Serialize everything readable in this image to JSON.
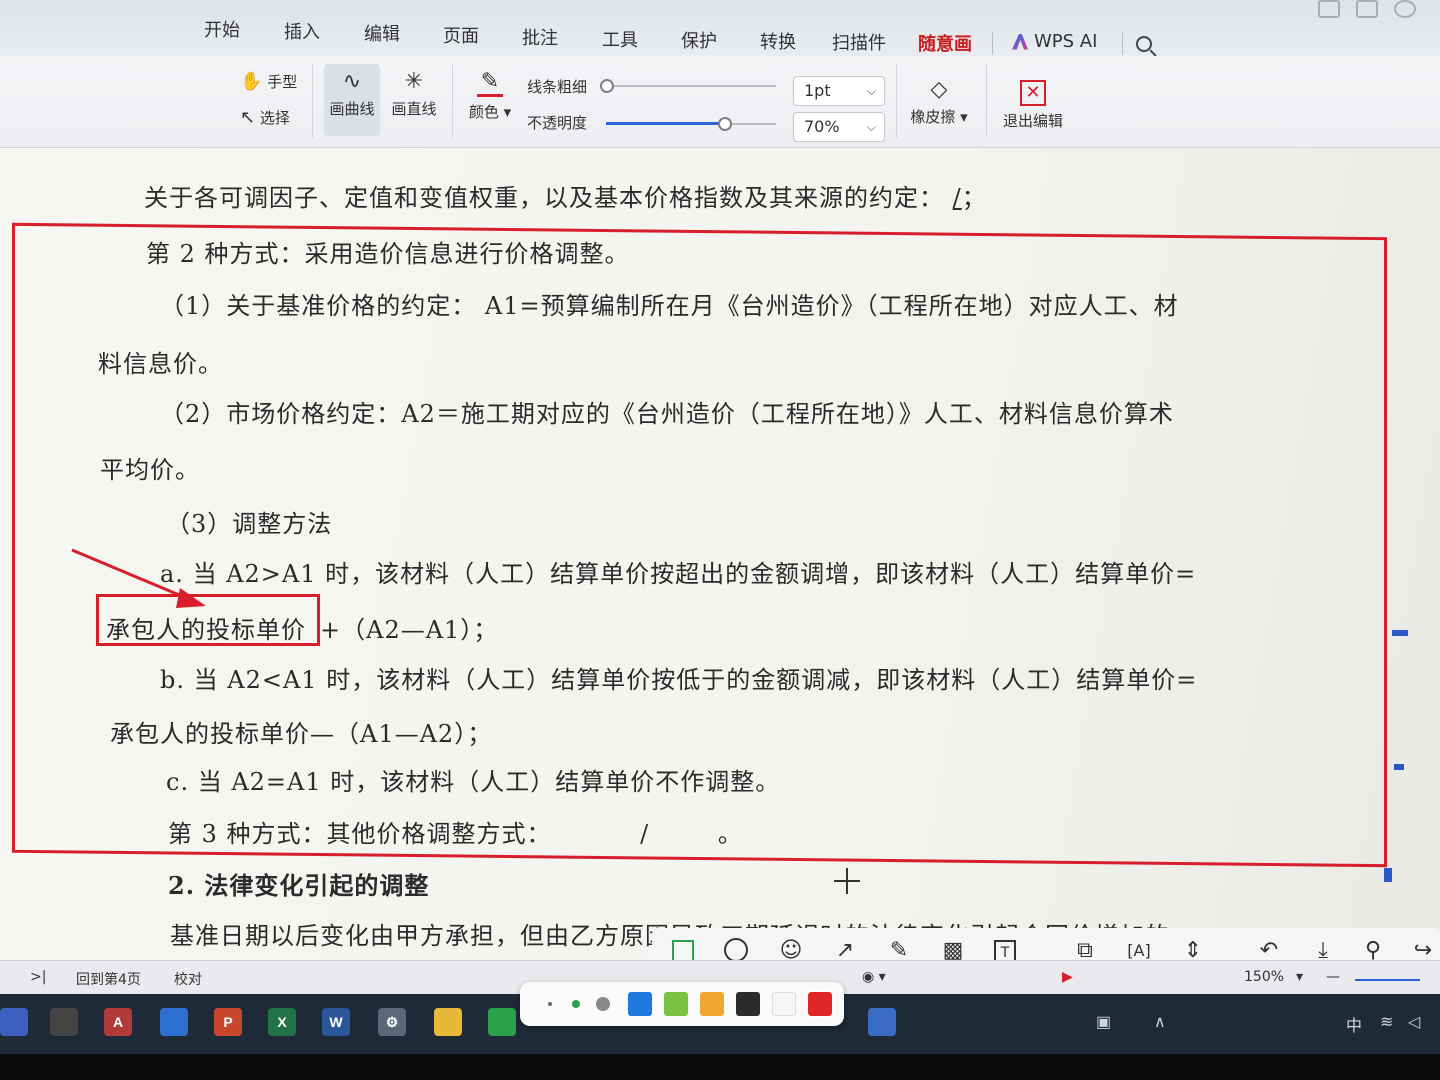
{
  "menu": {
    "tabs": [
      "开始",
      "插入",
      "编辑",
      "页面",
      "批注",
      "工具",
      "保护",
      "转换",
      "扫描件",
      "随意画"
    ],
    "active_tab": "随意画",
    "ai_label": "WPS AI"
  },
  "ribbon": {
    "hand_label": "手型",
    "select_label": "选择",
    "curve_label": "画曲线",
    "straight_label": "画直线",
    "color_label": "颜色",
    "thickness_label": "线条粗细",
    "opacity_label": "不透明度",
    "thickness_value": "1pt",
    "opacity_value": "70%",
    "opacity_level": 0.7,
    "eraser_label": "橡皮擦",
    "exit_label": "退出编辑",
    "accent_color": "#d81e2a"
  },
  "document": {
    "lines": [
      "关于各可调因子、定值和变值权重，以及基本价格指数及其来源的约定：",
      "第 2 种方式：采用造价信息进行价格调整。",
      "（1）关于基准价格的约定：  A1=预算编制所在月《台州造价》（工程所在地）对应人工、材",
      "料信息价。",
      "（2）市场价格约定：A2＝施工期对应的《台州造价（工程所在地）》人工、材料信息价算术",
      "平均价。",
      "（3）调整方法",
      "a. 当 A2>A1 时，该材料（人工）结算单价按超出的金额调增，即该材料（人工）结算单价=",
      "承包人的投标单价",
      "+（A2—A1）；",
      "b. 当 A2<A1 时，该材料（人工）结算单价按低于的金额调减，即该材料（人工）结算单价=",
      "承包人的投标单价—（A1—A2）；",
      "c. 当 A2=A1 时，该材料（人工）结算单价不作调整。",
      "第 3 种方式：其他价格调整方式：",
      "2.  法律变化引起的调整",
      "基准日期以后变化由甲方承担，但由乙方原因导致工期延误时的法律变化引起合同价增加的"
    ],
    "blank_value": "/",
    "blank_end": "；",
    "blank_end_2": "。",
    "annotation_color": "#d81e2a"
  },
  "status": {
    "page_button": "回到第4页",
    "proof_label": "校对",
    "zoom": "150%"
  },
  "palette": {
    "colors": [
      "#1f7ae0",
      "#7ac142",
      "#f0a830",
      "#2b2b2b",
      "#f5f5f5",
      "#e02626"
    ]
  }
}
